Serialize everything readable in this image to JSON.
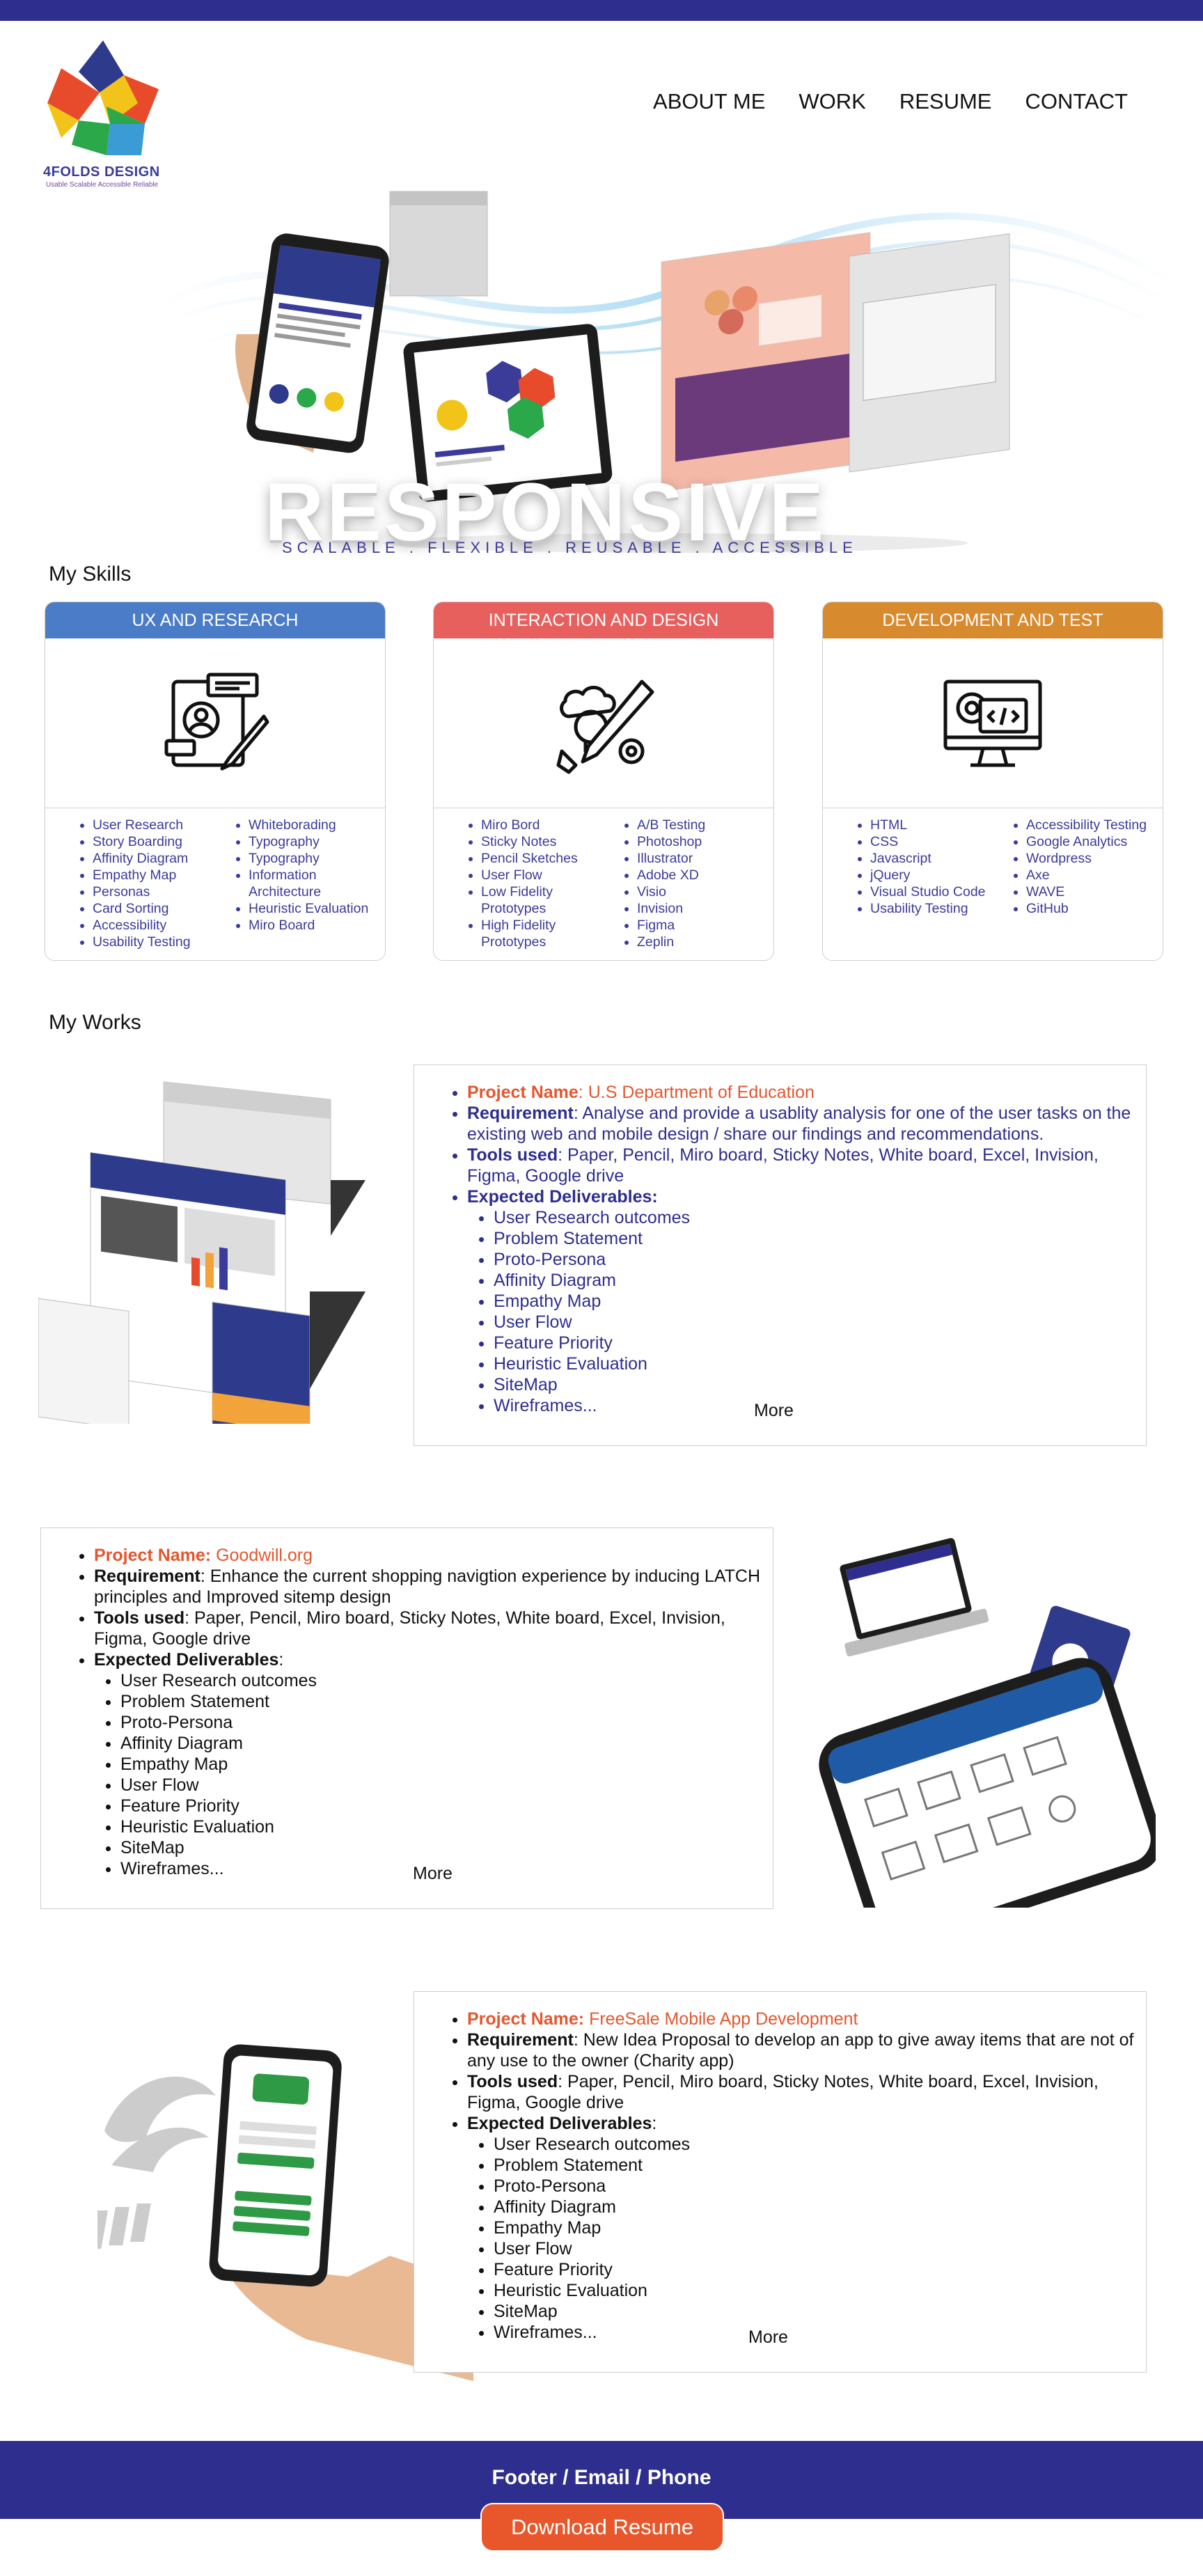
{
  "logo": {
    "name": "4FOLDS DESIGN",
    "tagline": "Usable Scalable Accessible Reliable"
  },
  "nav": {
    "about": "ABOUT ME",
    "work": "WORK",
    "resume": "RESUME",
    "contact": "CONTACT"
  },
  "hero": {
    "title": "RESPONSIVE",
    "subtitle": "SCALABLE . FLEXIBLE . REUSABLE . ACCESSIBLE"
  },
  "skills": {
    "heading": "My Skills",
    "cards": [
      {
        "title": "UX AND RESEARCH",
        "color": "#4a7cc7",
        "left": [
          "User Research",
          "Story Boarding",
          "Affinity Diagram",
          "Empathy Map",
          "Personas",
          "Card Sorting",
          "Accessibility",
          "Usability Testing"
        ],
        "right": [
          "Whiteborading",
          "Typography",
          "Typography",
          "Information Architecture",
          "Heuristic Evaluation",
          "Miro Board"
        ]
      },
      {
        "title": "INTERACTION AND DESIGN",
        "color": "#e8605e",
        "left": [
          "Miro Bord",
          "Sticky Notes",
          "Pencil Sketches",
          "User Flow",
          "Low Fidelity Prototypes",
          "High Fidelity Prototypes"
        ],
        "right": [
          "A/B Testing",
          "Photoshop",
          "Illustrator",
          "Adobe XD",
          "Visio",
          "Invision",
          "Figma",
          "Zeplin"
        ]
      },
      {
        "title": "DEVELOPMENT AND TEST",
        "color": "#d88a2e",
        "left": [
          "HTML",
          "CSS",
          "Javascript",
          "jQuery",
          "Visual Studio Code",
          "Usability Testing"
        ],
        "right": [
          "Accessibility Testing",
          "Google Analytics",
          "Wordpress",
          "Axe",
          "WAVE",
          "GitHub"
        ]
      }
    ]
  },
  "works": {
    "heading": "My Works",
    "projects": [
      {
        "name_label": "Project Name",
        "name": "U.S Department of Education",
        "req_label": "Requirement",
        "requirement": "Analyse and provide a usablity analysis for one of the user tasks on the existing web and mobile design / share our findings and recommendations.",
        "tools_label": "Tools used",
        "tools": "Paper, Pencil, Miro board, Sticky Notes, White board, Excel, Invision, Figma, Google drive",
        "deliv_label": "Expected Deliverables:",
        "deliverables": [
          "User Research outcomes",
          "Problem Statement",
          "Proto-Persona",
          "Affinity Diagram",
          "Empathy Map",
          "User Flow",
          "Feature Priority",
          "Heuristic Evaluation",
          "SiteMap",
          "Wireframes..."
        ],
        "more": "More"
      },
      {
        "name_label": "Project Name:",
        "name": "Goodwill.org",
        "req_label": "Requirement",
        "requirement": "Enhance the current shopping  navigtion experience by inducing LATCH principles and Improved sitemp design",
        "tools_label": "Tools used",
        "tools": "Paper, Pencil, Miro board, Sticky Notes, White board, Excel,  Invision, Figma, Google drive",
        "deliv_label": "Expected Deliverables",
        "deliverables": [
          "User Research outcomes",
          "Problem Statement",
          "Proto-Persona",
          "Affinity Diagram",
          "Empathy Map",
          "User Flow",
          "Feature Priority",
          "Heuristic Evaluation",
          "SiteMap",
          "Wireframes..."
        ],
        "more": "More"
      },
      {
        "name_label": "Project Name:",
        "name": "FreeSale Mobile App Development",
        "req_label": "Requirement",
        "requirement": "New Idea Proposal to develop an app to give away items that are not of any use to the owner (Charity app)",
        "tools_label": "Tools used",
        "tools": "Paper, Pencil, Miro board, Sticky Notes, White board, Excel,  Invision, Figma, Google drive",
        "deliv_label": "Expected Deliverables",
        "deliverables": [
          "User Research outcomes",
          "Problem Statement",
          "Proto-Persona",
          "Affinity Diagram",
          "Empathy Map",
          "User Flow",
          "Feature Priority",
          "Heuristic Evaluation",
          "SiteMap",
          "Wireframes..."
        ],
        "more": "More"
      }
    ]
  },
  "footer": {
    "text": "Footer /  Email / Phone",
    "download": "Download Resume"
  },
  "colors": {
    "brand": "#2e2e8e",
    "accent": "#e8572c"
  }
}
